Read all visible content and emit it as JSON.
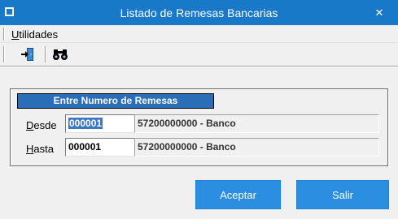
{
  "window": {
    "title": "Listado de Remesas Bancarias",
    "close_glyph": "✕",
    "colors": {
      "titlebar": "#1979c9",
      "button": "#2b8ee0",
      "group_header": "#2a6eb8"
    }
  },
  "menu": {
    "utilidades_accel": "U",
    "utilidades_rest": "tilidades"
  },
  "toolbar": {
    "icons": [
      "exit-door-icon",
      "binoculars-icon"
    ]
  },
  "group": {
    "header": "Entre Numero de Remesas",
    "rows": [
      {
        "label_accel": "D",
        "label_rest": "esde",
        "code": "000001",
        "description": "57200000000 - Banco"
      },
      {
        "label_accel": "H",
        "label_rest": "asta",
        "code": "000001",
        "description": "57200000000 - Banco"
      }
    ]
  },
  "buttons": {
    "accept": "Aceptar",
    "exit": "Salir"
  }
}
